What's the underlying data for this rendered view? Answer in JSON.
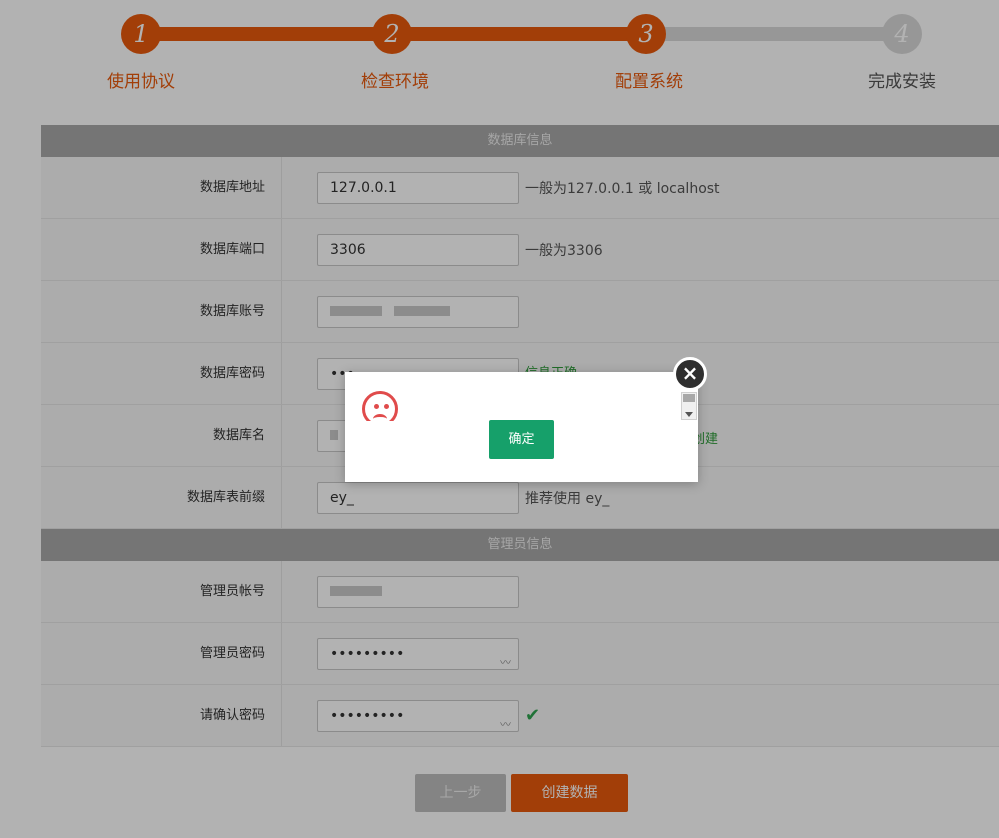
{
  "steps": [
    {
      "number": "1",
      "label": "使用协议",
      "status": "done"
    },
    {
      "number": "2",
      "label": "检查环境",
      "status": "done"
    },
    {
      "number": "3",
      "label": "配置系统",
      "status": "active"
    },
    {
      "number": "4",
      "label": "完成安装",
      "status": "todo"
    }
  ],
  "db_section": {
    "title": "数据库信息",
    "host": {
      "label": "数据库地址",
      "value": "127.0.0.1",
      "hint": "一般为127.0.0.1 或 localhost"
    },
    "port": {
      "label": "数据库端口",
      "value": "3306",
      "hint": "一般为3306"
    },
    "user": {
      "label": "数据库账号"
    },
    "password": {
      "label": "数据库密码",
      "value": "•••",
      "peek_hint": "信息正确"
    },
    "name": {
      "label": "数据库名",
      "peek_hint": "创建"
    },
    "prefix": {
      "label": "数据库表前缀",
      "value": "ey_",
      "hint": "推荐使用 ey_"
    }
  },
  "admin_section": {
    "title": "管理员信息",
    "account": {
      "label": "管理员帐号"
    },
    "password": {
      "label": "管理员密码",
      "value": "•••••••••"
    },
    "confirm": {
      "label": "请确认密码",
      "value": "•••••••••"
    }
  },
  "buttons": {
    "prev": "上一步",
    "create": "创建数据"
  },
  "dialog": {
    "ok_label": "确定",
    "close_glyph": "×"
  },
  "colors": {
    "accent": "#e8590c",
    "ok_green": "#16a06a",
    "error_red": "#e04b4b"
  }
}
